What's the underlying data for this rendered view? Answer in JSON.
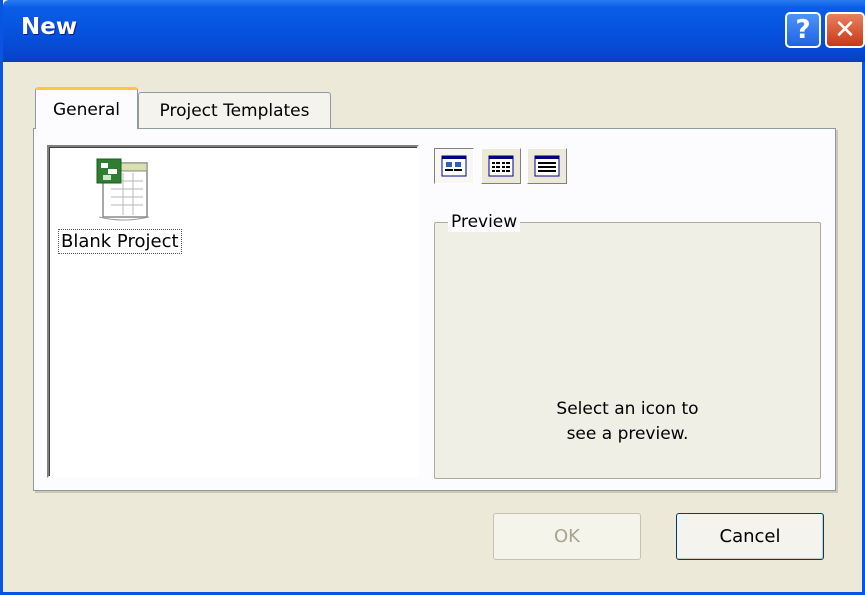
{
  "window": {
    "title": "New"
  },
  "titlebar": {
    "help_glyph": "?",
    "close_glyph": "✕"
  },
  "tabs": [
    {
      "label": "General",
      "active": true
    },
    {
      "label": "Project Templates",
      "active": false
    }
  ],
  "icons": [
    {
      "label": "Blank Project",
      "icon": "project-file-icon"
    }
  ],
  "view_buttons": [
    "large-icons-view-icon",
    "list-view-icon",
    "details-view-icon"
  ],
  "preview": {
    "legend": "Preview",
    "line1": "Select an icon to",
    "line2": "see a preview."
  },
  "buttons": {
    "ok": "OK",
    "cancel": "Cancel"
  },
  "colors": {
    "titlebar": "#0651dd",
    "dialog_bg": "#ece9d8",
    "close": "#c7391b"
  }
}
